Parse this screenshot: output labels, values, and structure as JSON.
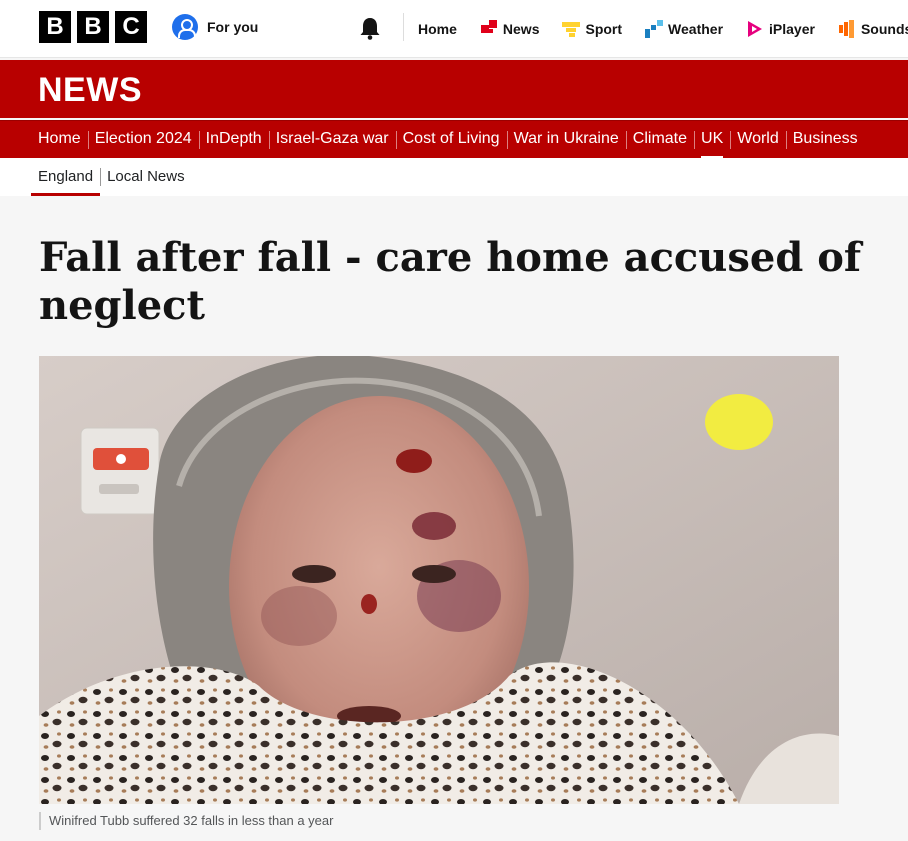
{
  "header": {
    "logo_letters": [
      "B",
      "B",
      "C"
    ],
    "for_you_label": "For you",
    "global_nav": [
      {
        "label": "Home",
        "icon": "none"
      },
      {
        "label": "News",
        "icon": "news-icon",
        "color": "#e0001a"
      },
      {
        "label": "Sport",
        "icon": "sport-icon",
        "color": "#ffd230"
      },
      {
        "label": "Weather",
        "icon": "weather-icon",
        "color": "#1a7fc0"
      },
      {
        "label": "iPlayer",
        "icon": "iplayer-icon",
        "color": "#e6007e"
      },
      {
        "label": "Sounds",
        "icon": "sounds-icon",
        "color": "#ff6600"
      }
    ]
  },
  "brand": {
    "title": "NEWS",
    "color": "#b80000"
  },
  "section_nav": [
    "Home",
    "Election 2024",
    "InDepth",
    "Israel-Gaza war",
    "Cost of Living",
    "War in Ukraine",
    "Climate",
    "UK",
    "World",
    "Business"
  ],
  "section_nav_active": "UK",
  "local_nav": [
    "England",
    "Local News"
  ],
  "local_nav_active": "England",
  "article": {
    "headline": "Fall after fall - care home accused of neglect",
    "image_caption": "Winifred Tubb suffered 32 falls in less than a year"
  }
}
